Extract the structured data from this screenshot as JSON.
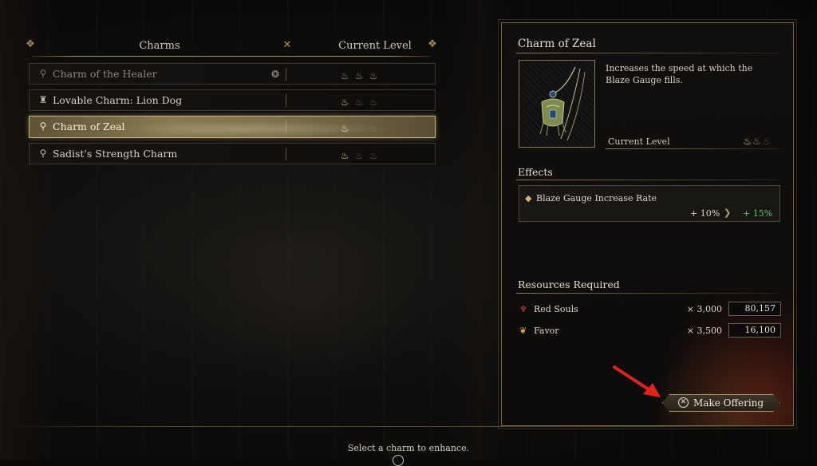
{
  "list": {
    "col_charms": "Charms",
    "col_level": "Current Level",
    "rows": [
      {
        "name": "Charm of the Healer",
        "icon": "charm-icon",
        "levels_on": 3,
        "equipped": true
      },
      {
        "name": "Lovable Charm: Lion Dog",
        "icon": "lion-dog-icon",
        "levels_on": 1
      },
      {
        "name": "Charm of Zeal",
        "icon": "charm-icon",
        "levels_on": 1,
        "selected": true
      },
      {
        "name": "Sadist's Strength Charm",
        "icon": "charm-icon",
        "levels_on": 1
      }
    ]
  },
  "detail": {
    "title": "Charm of Zeal",
    "description": "Increases the speed at which the Blaze Gauge fills.",
    "current_level_label": "Current Level",
    "effects_title": "Effects",
    "effect": {
      "name": "Blaze Gauge Increase Rate",
      "current": "+ 10%",
      "next": "+ 15%"
    },
    "resources_title": "Resources Required",
    "resources": [
      {
        "name": "Red Souls",
        "cost": "× 3,000",
        "owned": "80,157",
        "icon": "red-soul-icon",
        "color": "#d2473a"
      },
      {
        "name": "Favor",
        "cost": "× 3,500",
        "owned": "16,100",
        "icon": "favor-icon",
        "color": "#d8a94b"
      }
    ]
  },
  "actions": {
    "make_offering": "Make Offering",
    "make_offering_button_icon": "cross-button-icon"
  },
  "footer": {
    "hint": "Select a charm to enhance."
  },
  "colors": {
    "gold_accent": "#a88c5c",
    "pip_active": "#e9c27a",
    "increase_green": "#66c45a",
    "annotation_arrow": "#e0231c"
  }
}
